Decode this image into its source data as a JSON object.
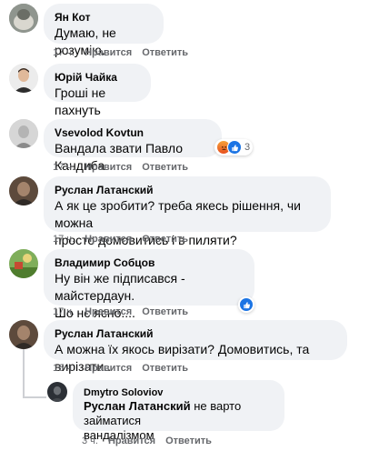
{
  "comments": [
    {
      "author": "Ян Кот",
      "text": "Думаю, не розумію.",
      "time": "17 ч."
    },
    {
      "author": "Юрій Чайка",
      "text": "Гроші не пахнуть",
      "time": ""
    },
    {
      "author": "Vsevolod Kovtun",
      "text": "Вандала звати Павло Кандиба",
      "time": "17 ч.",
      "reaction_count": "3"
    },
    {
      "author": "Руслан Латанский",
      "text": "А як це зробити? треба якесь рішення, чи можна\nпросто домовитись і в пиляти?",
      "time": "17 ч."
    },
    {
      "author": "Владимир Собцов",
      "text": "Ну він же підписався - майстердаун.\nШо нє ясно....",
      "time": "17 ч."
    },
    {
      "author": "Руслан Латанский",
      "text": "А можна їх якось вирізати? Домовитись, та вирізати..",
      "time": "16 ч."
    },
    {
      "author": "Dmytro Soloviov",
      "mention": "Руслан Латанский",
      "text": " не варто займатися\nвандалізмом",
      "time": "3 ч."
    }
  ],
  "actions": {
    "like": "Нравится",
    "reply": "Ответить"
  },
  "icons": {
    "angry": "angry-reaction-icon",
    "like": "like-reaction-icon"
  }
}
